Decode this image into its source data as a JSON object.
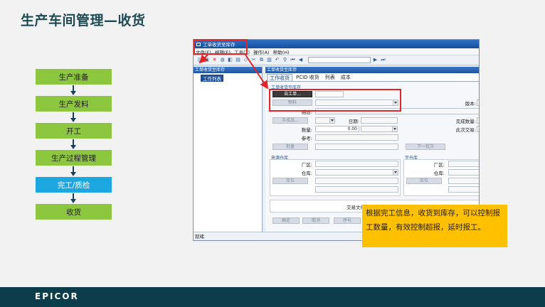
{
  "slide": {
    "title": "生产车间管理—收货"
  },
  "flow": {
    "steps": [
      "生产准备",
      "生产发料",
      "开工",
      "生产过程管理",
      "完工/质检",
      "收货"
    ],
    "active_index": 4
  },
  "window": {
    "title": "工单收货至库存",
    "menus": [
      "文件(F)",
      "编辑(E)",
      "工具(T)",
      "操作(A)",
      "帮助(H)"
    ],
    "left_header": "工单收货至库存",
    "tree_item": "工作列表",
    "right_header": "工单收货至库存",
    "tabs": [
      "工作收货",
      "PCID 收货",
      "列表",
      "成本"
    ],
    "active_tab": 0,
    "section_main": "工单收货至库存",
    "job_button": "自工单...",
    "material_button": "物料",
    "desc_label": "描述:",
    "semi_button": "半成品...",
    "date_label": "日期:",
    "qty_label": "数量:",
    "qty_value": "0.00",
    "ref_label": "参考:",
    "batch_button": "批量",
    "rev_label": "版本:",
    "completed_qty_label": "完成数量:",
    "this_trans_label": "此次交易:",
    "next_batch_button": "下一批次",
    "source_section": "来源仓库",
    "target_section": "至仓库",
    "plant_label": "厂区:",
    "warehouse_label": "仓库:",
    "bin_button": "库位",
    "trans_doc_label": "交易文件",
    "ok_button": "确定",
    "cancel_button": "取消",
    "serial_button": "序号",
    "status": "就绪"
  },
  "callout": {
    "text": "根据完工信息，收货到库存，可以控制报工数量，有效控制超报，延时报工。"
  },
  "footer": {
    "logo": "EPICOR"
  },
  "colors": {
    "title": "#1d4b55",
    "flow_step": "#8dc63f",
    "flow_active": "#1ca7e0",
    "callout": "#ffc000",
    "footer": "#0c3d4a",
    "highlight": "#e0262a"
  }
}
